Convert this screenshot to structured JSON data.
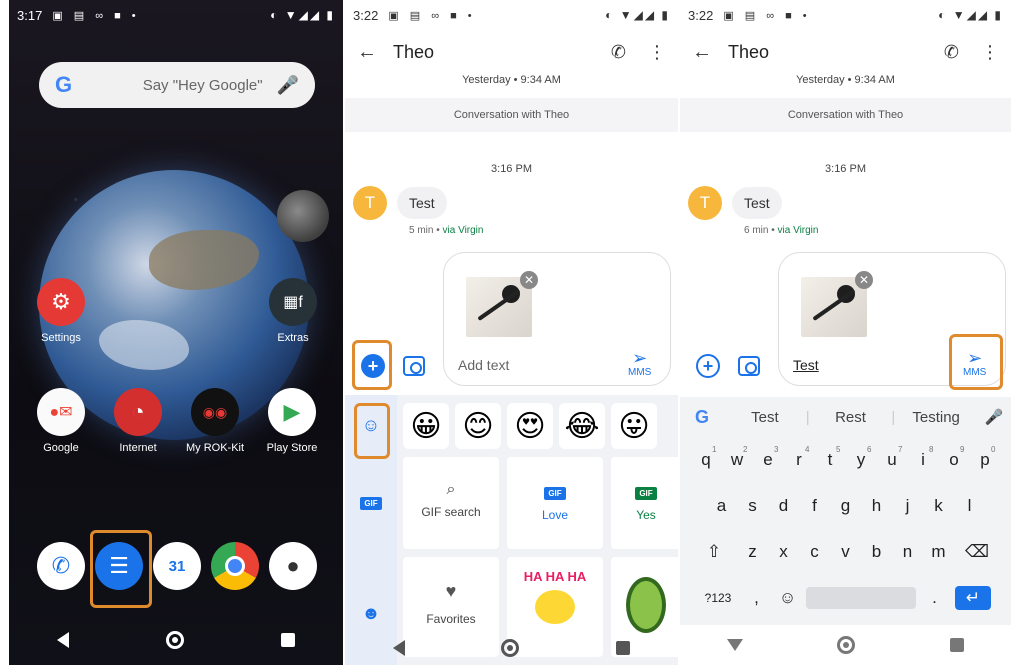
{
  "panel1": {
    "status": {
      "time": "3:17"
    },
    "search": {
      "placeholder": "Say \"Hey Google\""
    },
    "apps": [
      {
        "label": "Settings"
      },
      {
        "label": "Extras"
      },
      {
        "label": "Google"
      },
      {
        "label": "Internet"
      },
      {
        "label": "My ROK-Kit"
      },
      {
        "label": "Play Store"
      }
    ],
    "dock": {
      "calendar_day": "31"
    }
  },
  "panel2": {
    "status": {
      "time": "3:22"
    },
    "title": "Theo",
    "timestamp_top": "Yesterday • 9:34 AM",
    "conversation_label": "Conversation with Theo",
    "timestamp_mid": "3:16 PM",
    "avatar_letter": "T",
    "message": "Test",
    "meta_time": "5 min",
    "meta_via": "via Virgin",
    "compose_placeholder": "Add text",
    "send_label": "MMS",
    "gif_search": "GIF search",
    "gif_love": "Love",
    "gif_yes": "Yes",
    "favorites": "Favorites",
    "sticker_text": "HA HA HA",
    "gif_badge": "GIF",
    "emojis": [
      "😀",
      "😊",
      "😍",
      "😂",
      "😛"
    ]
  },
  "panel3": {
    "status": {
      "time": "3:22"
    },
    "title": "Theo",
    "timestamp_top": "Yesterday • 9:34 AM",
    "conversation_label": "Conversation with Theo",
    "timestamp_mid": "3:16 PM",
    "avatar_letter": "T",
    "message": "Test",
    "meta_time": "6 min",
    "meta_via": "via Virgin",
    "compose_value": "Test",
    "send_label": "MMS",
    "suggestions": [
      "Test",
      "Rest",
      "Testing"
    ],
    "keys_row1": [
      "q",
      "w",
      "e",
      "r",
      "t",
      "y",
      "u",
      "i",
      "o",
      "p"
    ],
    "keys_row1_nums": [
      "1",
      "2",
      "3",
      "4",
      "5",
      "6",
      "7",
      "8",
      "9",
      "0"
    ],
    "keys_row2": [
      "a",
      "s",
      "d",
      "f",
      "g",
      "h",
      "j",
      "k",
      "l"
    ],
    "keys_row3": [
      "z",
      "x",
      "c",
      "v",
      "b",
      "n",
      "m"
    ],
    "key_symbols": "?123",
    "key_comma": ",",
    "key_period": "."
  },
  "colors": {
    "highlight": "#e08a2e",
    "accent": "#1a73e8",
    "avatar": "#f6b73c"
  }
}
